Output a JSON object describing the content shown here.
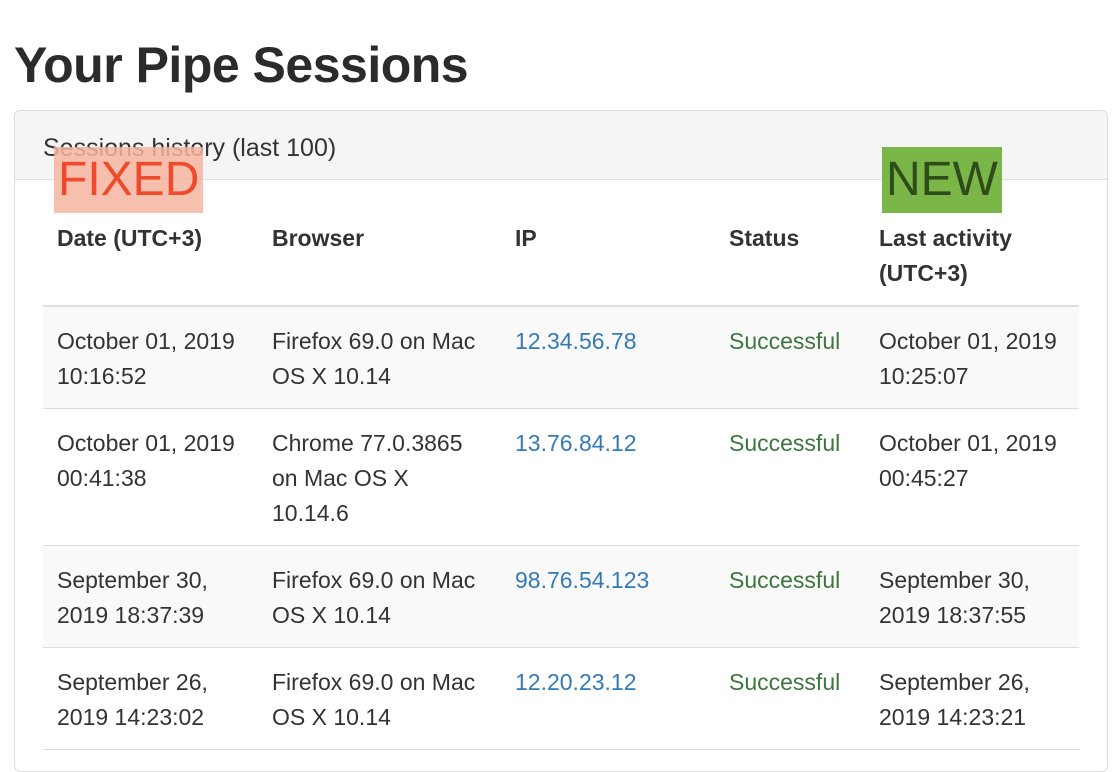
{
  "page": {
    "title": "Your Pipe Sessions"
  },
  "panel": {
    "title": "Sessions history (last 100)"
  },
  "annotations": {
    "fixed": "FIXED",
    "new": "NEW"
  },
  "colors": {
    "link": "#337ab7",
    "success": "#3c763d",
    "fixed_bg": "#f6b5a0",
    "fixed_text": "#ef4a2c",
    "new_bg": "#7ab648",
    "new_text": "#2f4d1a"
  },
  "table": {
    "headers": {
      "date": "Date (UTC+3)",
      "browser": "Browser",
      "ip": "IP",
      "status": "Status",
      "last_activity": "Last activity (UTC+3)"
    },
    "rows": [
      {
        "date": "October 01, 2019 10:16:52",
        "browser": "Firefox 69.0 on Mac OS X 10.14",
        "ip": "12.34.56.78",
        "status": "Successful",
        "last_activity": "October 01, 2019 10:25:07"
      },
      {
        "date": "October 01, 2019 00:41:38",
        "browser": "Chrome 77.0.3865 on Mac OS X 10.14.6",
        "ip": "13.76.84.12",
        "status": "Successful",
        "last_activity": "October 01, 2019 00:45:27"
      },
      {
        "date": "September 30, 2019 18:37:39",
        "browser": "Firefox 69.0 on Mac OS X 10.14",
        "ip": "98.76.54.123",
        "status": "Successful",
        "last_activity": "September 30, 2019 18:37:55"
      },
      {
        "date": "September 26, 2019 14:23:02",
        "browser": "Firefox 69.0 on Mac OS X 10.14",
        "ip": "12.20.23.12",
        "status": "Successful",
        "last_activity": "September 26, 2019 14:23:21"
      }
    ]
  }
}
